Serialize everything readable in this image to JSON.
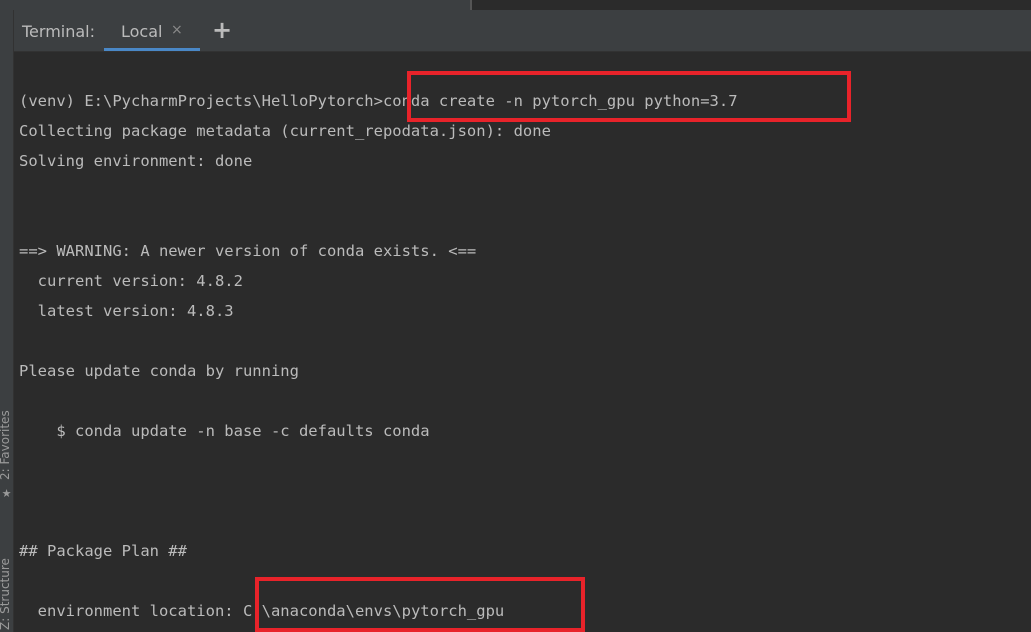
{
  "header": {
    "terminal_label": "Terminal:",
    "tab_label": "Local",
    "tab_close_glyph": "×",
    "add_tab_glyph": "+"
  },
  "side_strip": {
    "favorites_label": "2: Favorites",
    "structure_label": "Z: Structure",
    "star_glyph": "★"
  },
  "terminal": {
    "prompt_prefix": "(venv) E:\\PycharmProjects\\HelloPytorch",
    "command": ">conda create -n pytorch_gpu python=3.7",
    "lines": [
      "Collecting package metadata (current_repodata.json): done",
      "Solving environment: done",
      "==> WARNING: A newer version of conda exists. <==",
      "  current version: 4.8.2",
      "  latest version: 4.8.3",
      "Please update conda by running",
      "    $ conda update -n base -c defaults conda",
      "## Package Plan ##"
    ],
    "env_location_label": "  environment location:",
    "env_location_value": " C:\\anaconda\\envs\\pytorch_gpu"
  },
  "colors": {
    "background": "#2b2b2b",
    "header": "#3c3f41",
    "text": "#bbbbbb",
    "highlight": "#e8232a",
    "tab_underline": "#4a88c7"
  }
}
